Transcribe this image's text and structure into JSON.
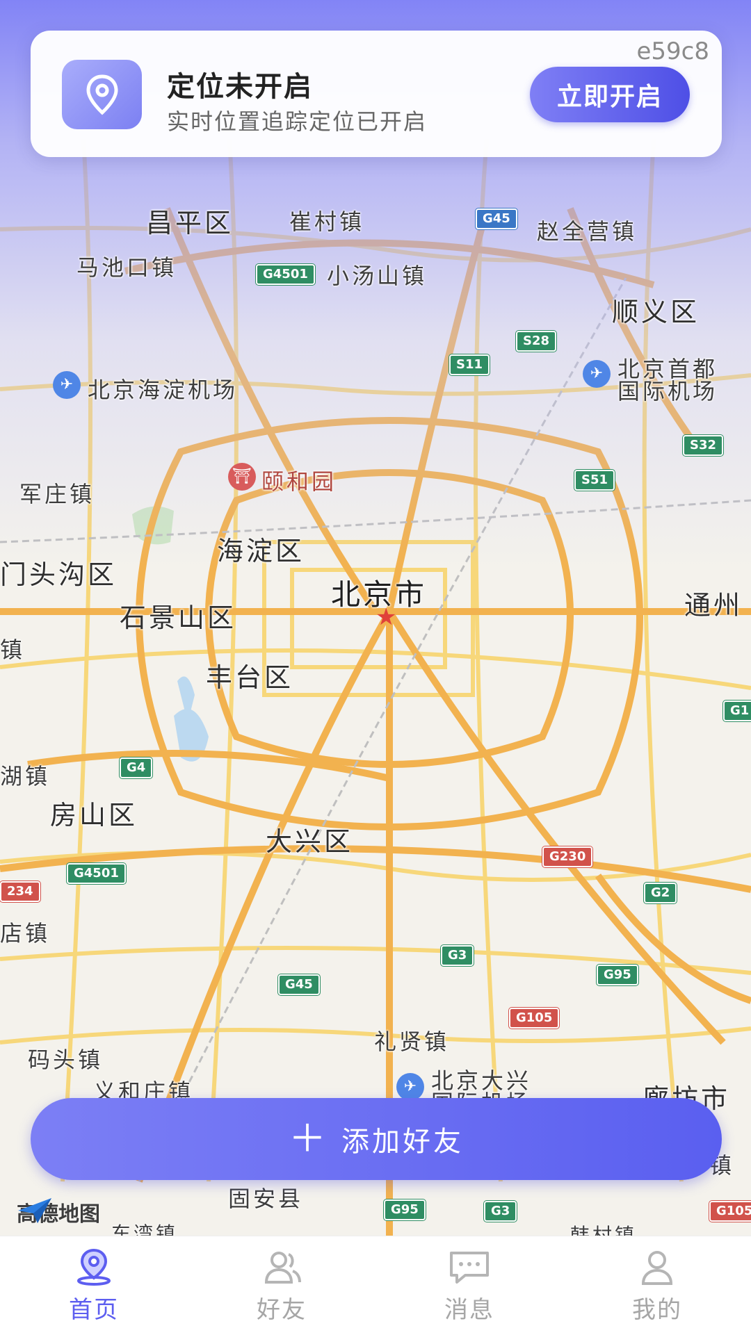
{
  "top_card": {
    "title": "定位未开启",
    "subtitle": "实时位置追踪定位已开启",
    "code": "e59c8",
    "enable_button": "立即开启"
  },
  "add_friend": {
    "label": "添加好友",
    "icon": "plus-icon"
  },
  "map": {
    "provider": "高德地图",
    "labels": {
      "changping": "昌平区",
      "cuicun": "崔村镇",
      "zhaoquanying": "赵全营镇",
      "machikou": "马池口镇",
      "xiaotangshan": "小汤山镇",
      "shunyi": "顺义区",
      "haidian_airport": "北京海淀机场",
      "capital_airport_1": "北京首都",
      "capital_airport_2": "国际机场",
      "junzhuang": "军庄镇",
      "yiheyuan": "颐和园",
      "haidian": "海淀区",
      "mentougou": "门头沟区",
      "beijing": "北京市",
      "tongzhou": "通州",
      "shijingshan": "石景山区",
      "zhen_left": "镇",
      "fengtai": "丰台区",
      "hu_zhen": "湖镇",
      "fangshan": "房山区",
      "daxing": "大兴区",
      "dian_zhen": "店镇",
      "lixian": "礼贤镇",
      "matou": "码头镇",
      "daxing_airport_1": "北京大兴",
      "daxing_airport_2": "国际机场",
      "yihezhuang": "义和庄镇",
      "langfang": "廊坊市",
      "gu_an": "固安县",
      "dongwan": "东湾镇",
      "hancun": "韩村镇",
      "zhen_right": "镇"
    },
    "road_shields": {
      "g45_top": "G45",
      "g4501_top": "G4501",
      "s28": "S28",
      "s11": "S11",
      "s32": "S32",
      "s51": "S51",
      "g4": "G4",
      "g4501_bottom": "G4501",
      "g230": "G230",
      "g2": "G2",
      "g3": "G3",
      "g95": "G95",
      "g45_bottom": "G45",
      "g105": "G105",
      "g95_bottom": "G95",
      "g3_bottom": "G3",
      "g234": "234",
      "g1": "G1",
      "g105_edge": "G105"
    }
  },
  "bottom_nav": [
    {
      "label": "首页",
      "icon": "home-location-icon",
      "active": true
    },
    {
      "label": "好友",
      "icon": "friends-icon",
      "active": false
    },
    {
      "label": "消息",
      "icon": "message-icon",
      "active": false
    },
    {
      "label": "我的",
      "icon": "profile-icon",
      "active": false
    }
  ],
  "colors": {
    "accent": "#5d5ef0",
    "gradient_top": "#7c7ef6",
    "road_major": "#f2b24f",
    "road_minor": "#f7d77a"
  }
}
